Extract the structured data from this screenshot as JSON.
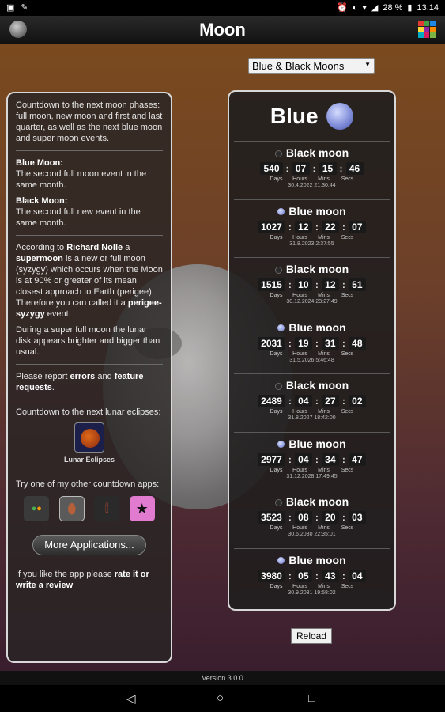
{
  "status": {
    "battery": "28 %",
    "time": "13:14"
  },
  "appbar": {
    "title": "Moon"
  },
  "filter": {
    "selected": "Blue & Black Moons"
  },
  "left": {
    "intro": "Countdown to the next moon phases: full moon, new moon and first and last quarter, as well as the next blue moon and super moon events.",
    "blue_title": "Blue Moon:",
    "blue_text": "The second full moon event in the same month.",
    "black_title": "Black Moon:",
    "black_text": "The second full new event in the same month.",
    "super_1": "According to",
    "super_name": "Richard Nolle",
    "super_2": "a",
    "super_bold": "supermoon",
    "super_3": "is a new or full moon (syzygy) which occurs when the Moon is at 90% or greater of its mean closest approach to Earth (perigee). Therefore you can called it a",
    "super_bold2": "perigee-syzygy",
    "super_4": "event.",
    "super_full": "During a super full moon the lunar disk appears brighter and bigger than usual.",
    "report_1": "Please report",
    "report_errors": "errors",
    "report_and": "and",
    "report_feature": "feature requests",
    "report_end": ".",
    "eclipse_intro": "Countdown to the next lunar eclipses:",
    "eclipse_label": "Lunar Eclipses",
    "other_apps": "Try one of my other countdown apps:",
    "more_apps": "More Applications...",
    "rate_1": "If you like the app please",
    "rate_bold": "rate it or write a review"
  },
  "panel": {
    "title": "Blue",
    "units": [
      "Days",
      "Hours",
      "Mins",
      "Secs"
    ],
    "events": [
      {
        "name": "Black moon",
        "kind": "black",
        "d": "540",
        "h": "07",
        "m": "15",
        "s": "46",
        "date": "30.4.2022 21:30:44"
      },
      {
        "name": "Blue moon",
        "kind": "blue",
        "d": "1027",
        "h": "12",
        "m": "22",
        "s": "07",
        "date": "31.8.2023 2:37:55"
      },
      {
        "name": "Black moon",
        "kind": "black",
        "d": "1515",
        "h": "10",
        "m": "12",
        "s": "51",
        "date": "30.12.2024 23:27:49"
      },
      {
        "name": "Blue moon",
        "kind": "blue",
        "d": "2031",
        "h": "19",
        "m": "31",
        "s": "48",
        "date": "31.5.2026 5:46:48"
      },
      {
        "name": "Black moon",
        "kind": "black",
        "d": "2489",
        "h": "04",
        "m": "27",
        "s": "02",
        "date": "31.8.2027 18:42:00"
      },
      {
        "name": "Blue moon",
        "kind": "blue",
        "d": "2977",
        "h": "04",
        "m": "34",
        "s": "47",
        "date": "31.12.2028 17:49:45"
      },
      {
        "name": "Black moon",
        "kind": "black",
        "d": "3523",
        "h": "08",
        "m": "20",
        "s": "03",
        "date": "30.6.2030 22:35:01"
      },
      {
        "name": "Blue moon",
        "kind": "blue",
        "d": "3980",
        "h": "05",
        "m": "43",
        "s": "04",
        "date": "30.9.2031 19:58:02"
      }
    ]
  },
  "reload": "Reload",
  "version": "Version 3.0.0"
}
